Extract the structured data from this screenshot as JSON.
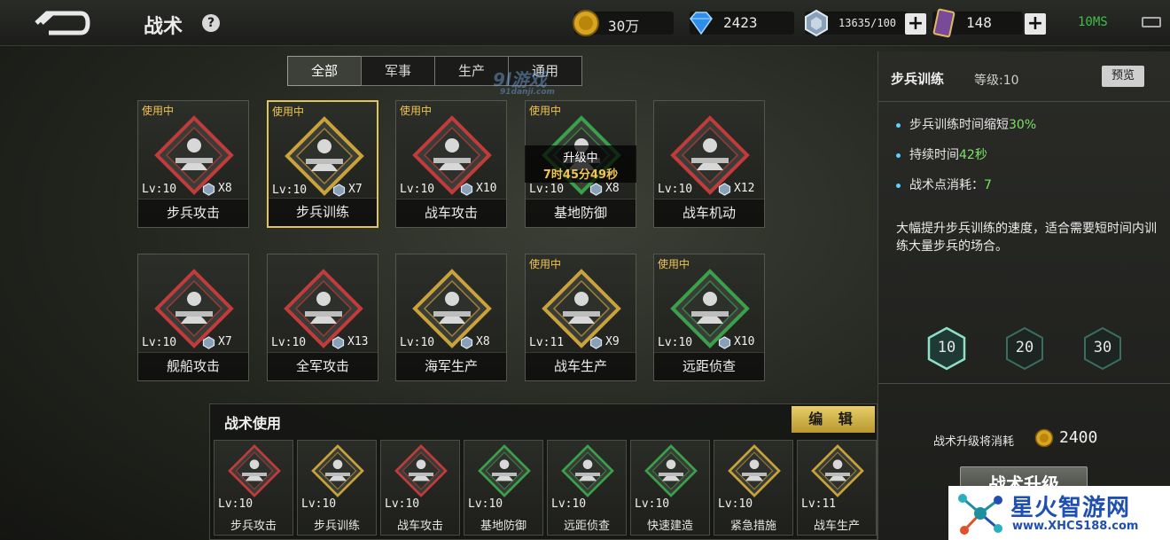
{
  "header": {
    "title": "战术",
    "help": "?",
    "resources": {
      "gold": "30万",
      "diamond": "2423",
      "crystal": "13635/100",
      "card": "148"
    },
    "plus": "+",
    "network": "10MS"
  },
  "tabs": [
    "全部",
    "军事",
    "生产",
    "通用"
  ],
  "watermark": {
    "main": "9l游戏",
    "sub": "91danji.com"
  },
  "tactics": [
    {
      "status": "使用中",
      "lv": "Lv:10",
      "cost": "X8",
      "name": "步兵攻击",
      "color": "#c23b3b"
    },
    {
      "status": "使用中",
      "lv": "Lv:10",
      "cost": "X7",
      "name": "步兵训练",
      "color": "#c9a23a"
    },
    {
      "status": "使用中",
      "lv": "Lv:10",
      "cost": "X10",
      "name": "战车攻击",
      "color": "#c23b3b"
    },
    {
      "status": "使用中",
      "lv": "Lv:10",
      "cost": "X8",
      "name": "基地防御",
      "color": "#3aa04a",
      "upgrading": "升级中",
      "timer": "7时45分49秒"
    },
    {
      "status": "",
      "lv": "Lv:10",
      "cost": "X12",
      "name": "战车机动",
      "color": "#c23b3b"
    },
    {
      "status": "",
      "lv": "Lv:10",
      "cost": "X7",
      "name": "舰船攻击",
      "color": "#c23b3b"
    },
    {
      "status": "",
      "lv": "Lv:10",
      "cost": "X13",
      "name": "全军攻击",
      "color": "#c23b3b"
    },
    {
      "status": "",
      "lv": "Lv:10",
      "cost": "X8",
      "name": "海军生产",
      "color": "#c9a23a"
    },
    {
      "status": "使用中",
      "lv": "Lv:11",
      "cost": "X9",
      "name": "战车生产",
      "color": "#c9a23a"
    },
    {
      "status": "使用中",
      "lv": "Lv:10",
      "cost": "X10",
      "name": "远距侦查",
      "color": "#3aa04a"
    }
  ],
  "detail": {
    "name": "步兵训练",
    "level": "等级:10",
    "preview": "预览",
    "effects": [
      {
        "text": "步兵训练时间缩短",
        "value": "30%"
      },
      {
        "text": "持续时间",
        "value": "42秒"
      },
      {
        "text": "战术点消耗：",
        "value": "7"
      }
    ],
    "description": "大幅提升步兵训练的速度，适合需要短时间内训练大量步兵的场合。",
    "levels": [
      "10",
      "20",
      "30"
    ],
    "upgrade_cost_label": "战术升级将消耗",
    "upgrade_cost": "2400",
    "upgrade_button": "战术升级"
  },
  "usebar": {
    "title": "战术使用",
    "edit": "编 辑",
    "slots": [
      {
        "lv": "Lv:10",
        "name": "步兵攻击",
        "color": "#c23b3b"
      },
      {
        "lv": "Lv:10",
        "name": "步兵训练",
        "color": "#c9a23a"
      },
      {
        "lv": "Lv:10",
        "name": "战车攻击",
        "color": "#c23b3b"
      },
      {
        "lv": "Lv:10",
        "name": "基地防御",
        "color": "#3aa04a"
      },
      {
        "lv": "Lv:10",
        "name": "远距侦查",
        "color": "#3aa04a"
      },
      {
        "lv": "Lv:10",
        "name": "快速建造",
        "color": "#3aa04a"
      },
      {
        "lv": "Lv:10",
        "name": "紧急措施",
        "color": "#c9a23a"
      },
      {
        "lv": "Lv:11",
        "name": "战车生产",
        "color": "#c9a23a"
      }
    ]
  },
  "brand": {
    "name": "星火智游网",
    "url": "www.XHCS188.com"
  },
  "colors": {
    "accent_gold": "#e2c55a",
    "effect_green": "#7ee06a",
    "net_green": "#3fbf4a"
  }
}
